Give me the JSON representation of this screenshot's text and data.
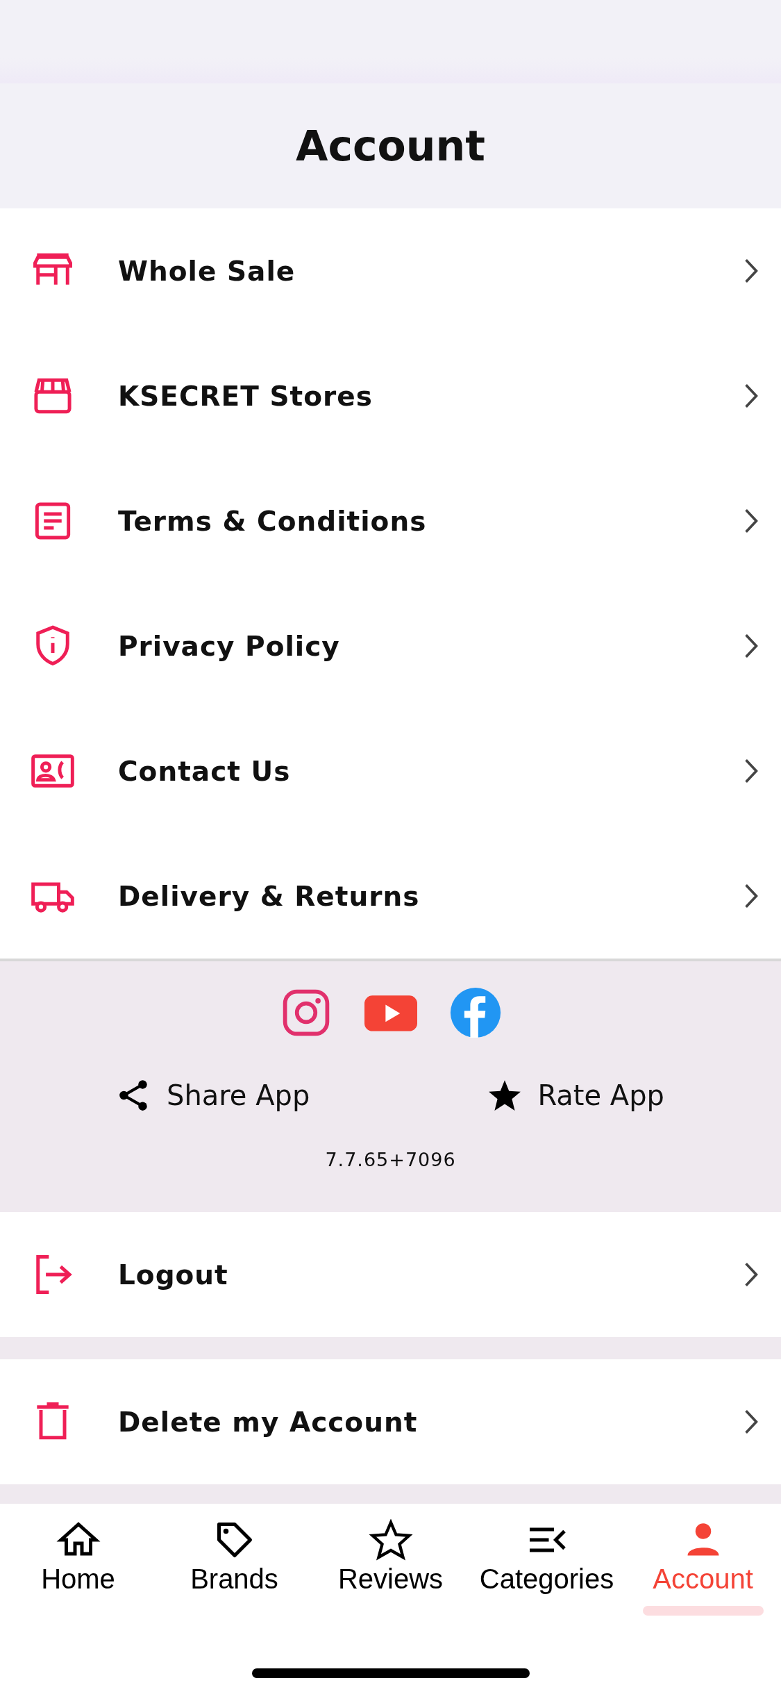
{
  "header": {
    "title": "Account"
  },
  "menu": [
    {
      "kind": "wholesale",
      "label": "Whole Sale"
    },
    {
      "kind": "store",
      "label": "KSECRET Stores"
    },
    {
      "kind": "document",
      "label": "Terms & Conditions"
    },
    {
      "kind": "shield",
      "label": "Privacy Policy"
    },
    {
      "kind": "contact",
      "label": "Contact Us"
    },
    {
      "kind": "truck",
      "label": "Delivery & Returns"
    }
  ],
  "social_links": [
    {
      "kind": "instagram"
    },
    {
      "kind": "youtube"
    },
    {
      "kind": "facebook"
    }
  ],
  "app_actions": [
    {
      "kind": "share",
      "label": "Share App"
    },
    {
      "kind": "rate",
      "label": "Rate App"
    }
  ],
  "version": "7.7.65+7096",
  "account_actions": [
    {
      "kind": "logout",
      "label": "Logout"
    },
    {
      "kind": "delete",
      "label": "Delete my Account"
    }
  ],
  "tab_bar": [
    {
      "kind": "home",
      "label": "Home",
      "selected": false
    },
    {
      "kind": "tag",
      "label": "Brands",
      "selected": false
    },
    {
      "kind": "star",
      "label": "Reviews",
      "selected": false
    },
    {
      "kind": "categories",
      "label": "Categories",
      "selected": false
    },
    {
      "kind": "person",
      "label": "Account",
      "selected": true
    }
  ]
}
